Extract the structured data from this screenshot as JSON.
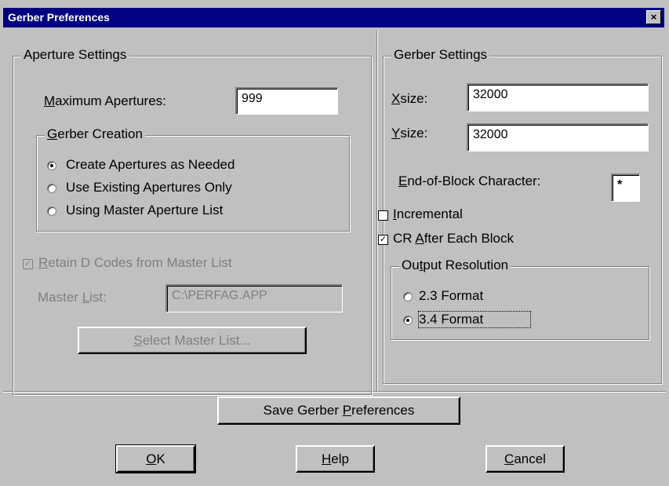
{
  "window": {
    "title": "Gerber Preferences",
    "close_glyph": "×"
  },
  "aperture": {
    "legend": "Aperture Settings",
    "max_label_mn": "M",
    "max_label_rest": "aximum Apertures:",
    "max_value": "999",
    "creation": {
      "legend_mn": "G",
      "legend_rest": "erber Creation",
      "options": [
        {
          "label": "Create Apertures as Needed",
          "selected": true
        },
        {
          "label": "Use Existing Apertures Only",
          "selected": false
        },
        {
          "label": "Using Master Aperture List",
          "selected": false
        }
      ]
    },
    "retain_mn": "R",
    "retain_rest": "etain D Codes from Master List",
    "retain_checked": true,
    "master_label_a": "Master ",
    "master_label_mn": "L",
    "master_label_b": "ist:",
    "master_value": "C:\\PERFAG.APP",
    "select_mn": "S",
    "select_rest": "elect Master List..."
  },
  "gerber": {
    "legend": "Gerber Settings",
    "xsize_mn": "X",
    "xsize_rest": "size:",
    "xsize_value": "32000",
    "ysize_mn": "Y",
    "ysize_rest": "size:",
    "ysize_value": "32000",
    "eob_mn": "E",
    "eob_rest": "nd-of-Block Character:",
    "eob_value": "*",
    "incremental_mn": "I",
    "incremental_rest": "ncremental",
    "incremental_checked": false,
    "cr_a": "CR ",
    "cr_mn": "A",
    "cr_rest": "fter Each Block",
    "cr_checked": true,
    "resolution": {
      "legend_a": "Ou",
      "legend_mn": "t",
      "legend_rest": "put Resolution",
      "options": [
        {
          "label": "2.3 Format",
          "selected": false
        },
        {
          "label": "3.4 Format",
          "selected": true
        }
      ]
    }
  },
  "buttons": {
    "save_a": "Save Gerber ",
    "save_mn": "P",
    "save_rest": "references",
    "ok_mn": "O",
    "ok_rest": "K",
    "help_mn": "H",
    "help_rest": "elp",
    "cancel_mn": "C",
    "cancel_rest": "ancel"
  },
  "icons": {
    "check": "✓",
    "close": "close-icon",
    "radio": "radio-icon"
  }
}
